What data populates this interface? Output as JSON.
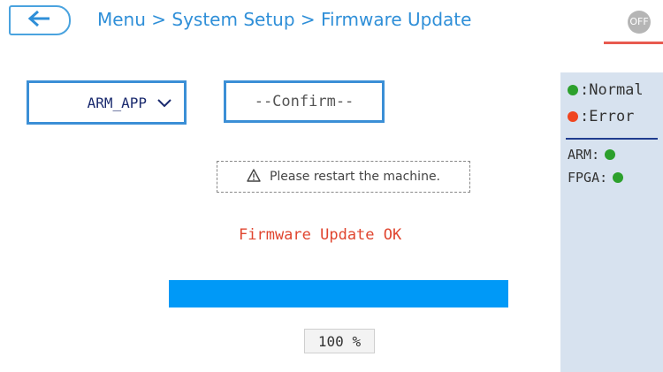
{
  "header": {
    "back_icon": "arrow-left-icon",
    "breadcrumb": "Menu > System Setup > Firmware Update",
    "status_badge": "OFF",
    "accent": "#2f8fd8",
    "alert_accent": "#e85a4f"
  },
  "main": {
    "dropdown": {
      "selected": "ARM_APP",
      "icon": "chevron-down-icon"
    },
    "confirm_label": "--Confirm--",
    "notice": {
      "icon": "warning-triangle-icon",
      "text": "Please restart the machine."
    },
    "message": "Firmware Update OK",
    "message_color": "#e0452f",
    "progress": {
      "value": 100,
      "label": "100 %",
      "color": "#0099f7"
    }
  },
  "sidebar": {
    "legend": [
      {
        "label": ":Normal",
        "color": "#2ca02c"
      },
      {
        "label": ":Error",
        "color": "#f0451f"
      }
    ],
    "status": [
      {
        "label": "ARM:",
        "state": "normal",
        "color": "#2ca02c"
      },
      {
        "label": "FPGA:",
        "state": "normal",
        "color": "#2ca02c"
      }
    ]
  }
}
